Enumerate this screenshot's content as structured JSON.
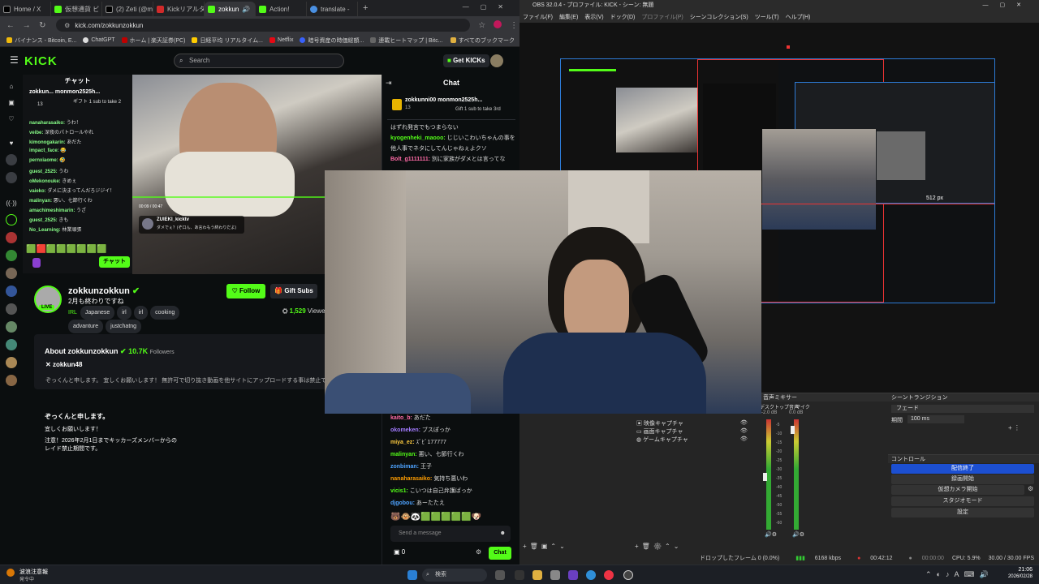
{
  "browser": {
    "tabs": [
      {
        "label": "Home / X",
        "color": "#00000000",
        "icon": "x-icon"
      },
      {
        "label": "仮想通貨 ビ",
        "color": "#53fc18",
        "icon": "kick-icon"
      },
      {
        "label": "(2) Zeti (@m",
        "color": "#00000000",
        "icon": "x-icon"
      },
      {
        "label": "Kickリアルタ",
        "color": "#d12a2a",
        "icon": "kick-icon"
      },
      {
        "label": "zokkun",
        "color": "#53fc18",
        "icon": "kick-icon"
      },
      {
        "label": "Action!",
        "color": "#53fc18",
        "icon": "kick-icon"
      },
      {
        "label": "translate -",
        "color": "#4a90e2",
        "icon": "google-icon"
      }
    ],
    "url": "kick.com/zokkunzokkun",
    "bookmarks": [
      "バイナンス - Bitcoin, E...",
      "ChatGPT",
      "ホーム | 楽天証券(PC)",
      "日経平均 リアルタイム...",
      "Netflix",
      "暗号資産の時価総額...",
      "連載ヒートマップ | Bitc...",
      "すべてのブックマーク"
    ]
  },
  "kick": {
    "logo": "KICK",
    "search_placeholder": "Search",
    "get_kicks": "Get KICKs",
    "mini_chat": {
      "title": "チャット",
      "pinned_user": "zokkun...",
      "pinned_gift_user": "monmon2525h...",
      "pinned_gift_text": "ギフト 1 sub to take 2",
      "pinned_count": "13",
      "messages": [
        {
          "user": "nanaharasaiko:",
          "text": "うわ！"
        },
        {
          "user": "veibe:",
          "text": "深夜のパトロールやれ"
        },
        {
          "user": "kimonogakarin:",
          "text": "あだた"
        },
        {
          "user": "impact_face:",
          "text": "😂"
        },
        {
          "user": "pernxiaome:",
          "text": "🤣"
        },
        {
          "user": "guest_2525:",
          "text": "うわ"
        },
        {
          "user": "oMekonouke:",
          "text": "きめぇ"
        },
        {
          "user": "vaieko:",
          "text": "ダメに決まってんだろジジイ！"
        },
        {
          "user": "malinyan:",
          "text": "悪い、七節行くわ"
        },
        {
          "user": "amachimeshimarin:",
          "text": "うざ"
        },
        {
          "user": "guest_2525:",
          "text": "きも"
        },
        {
          "user": "No_Learning:",
          "text": "林業頑張"
        }
      ],
      "chat_button": "チャット"
    },
    "video": {
      "time": "00:09 / 00:47",
      "clip_user": "ZUIEKI_kicktv",
      "clip_text": "ダメでぇ？(ぞ口ん、あ言わもう終わりだよ)"
    },
    "channel": {
      "name": "zokkunzokkun",
      "title": "2月も終わりですね",
      "live_badge": "LIVE",
      "tags": [
        "IRL",
        "Japanese",
        "irl",
        "irl",
        "cooking",
        "advanture",
        "justchatng"
      ],
      "follow": "Follow",
      "gift_subs": "Gift Subs",
      "viewers": "1,529",
      "viewers_label": "Viewe",
      "about_title": "About zokkunzokkun",
      "followers": "10.7K",
      "followers_label": "Followers",
      "x_handle": "zokkun48",
      "about_text": "ぞっくんと申します。 宜しくお願いします！ 無許可で切り抜き動画を他サイトにアップロードする事は禁止で",
      "bio_heading": "ぞっくんと申します。",
      "bio_line1": "宜しくお願いします！",
      "bio_line2": "注意！2026年2月1日までキッカーズメンバーからの",
      "bio_line3": "レイド禁止期間です。"
    },
    "chat": {
      "title": "Chat",
      "pinned_user": "zokkunni00",
      "pinned_gift_user": "monmon2525h...",
      "pinned_gift_text": "Gift 1 sub to take 3rd",
      "pinned_count": "13",
      "top_messages": [
        {
          "user": "",
          "text": "はずれ発言でもつまらない"
        },
        {
          "user": "kyogenheki_maooo:",
          "text": "じじいこわいちゃんの事を"
        },
        {
          "user": "",
          "text": "他人事でネタにしてんじゃねぇよクソ"
        },
        {
          "user": "Bolt_g1111111:",
          "text": "別に家族がダメとは言ってな"
        }
      ],
      "bottom_messages": [
        {
          "user": "kaito_b:",
          "text": "あだた"
        },
        {
          "user": "okomeken:",
          "text": "ブスぽっか"
        },
        {
          "user": "miya_ez:",
          "text": "ｽﾞﾋﾞ177777"
        },
        {
          "user": "malinyan:",
          "text": "悪い、七節行くわ"
        },
        {
          "user": "zonbiman:",
          "text": "王子"
        },
        {
          "user": "nanaharasaiko:",
          "text": "気持ち悪いわ"
        },
        {
          "user": "vicis1:",
          "text": "こいつは自己弁護ばっか"
        },
        {
          "user": "djgobou:",
          "text": "あーたたえ"
        }
      ],
      "send_placeholder": "Send a message",
      "kicks_count": "0",
      "chat_button": "Chat"
    }
  },
  "obs": {
    "title": "OBS 32.0.4 - プロファイル: KICK - シーン: 無題",
    "menu": [
      "ファイル(F)",
      "編集(E)",
      "表示(V)",
      "ドック(D)",
      "プロファイル(P)",
      "シーンコレクション(S)",
      "ツール(T)",
      "ヘルプ(H)"
    ],
    "size_readout": "512 px",
    "sources": [
      "映像キャプチャ",
      "画面キャプチャ",
      "ゲームキャプチャ"
    ],
    "mixer": {
      "title": "音声ミキサー",
      "ch1": "デスクトップ音声",
      "ch2": "マイク",
      "ch1_db": "-2.0 dB",
      "ch2_db": "0.0 dB",
      "scale": [
        "-5",
        "-10",
        "-15",
        "-20",
        "-25",
        "-30",
        "-35",
        "-40",
        "-45",
        "-50",
        "-55",
        "-60"
      ]
    },
    "transitions": {
      "title": "シーントランジション",
      "type": "フェード",
      "duration_label": "期間",
      "duration": "100 ms"
    },
    "controls": {
      "title": "コントロール",
      "buttons": [
        "配信終了",
        "録画開始",
        "仮想カメラ開始",
        "スタジオモード",
        "設定"
      ]
    },
    "status": {
      "dropped": "ドロップしたフレーム 0 (0.0%)",
      "bitrate": "6168 kbps",
      "stream_time": "00:42:12",
      "rec_time": "00:00:00",
      "cpu": "CPU: 5.9%",
      "fps": "30.00 / 30.00 FPS"
    }
  },
  "taskbar": {
    "weather_title": "波浪注意報",
    "weather_sub": "発令中",
    "search": "検索",
    "time": "21:06",
    "date": "2026/02/28"
  }
}
